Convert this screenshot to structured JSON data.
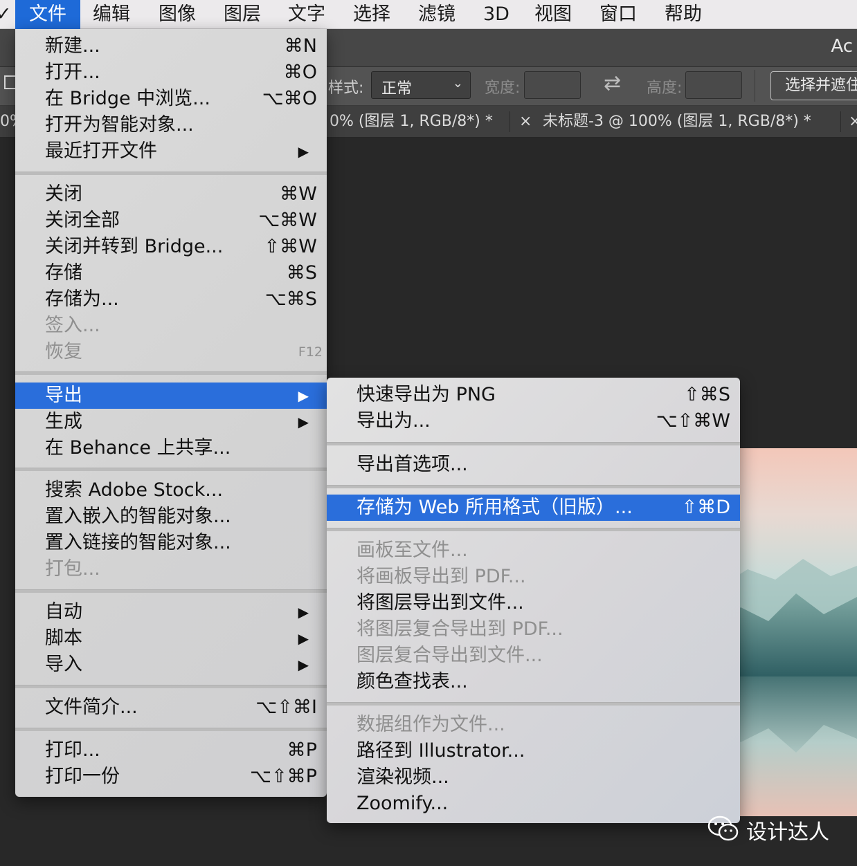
{
  "menubar": {
    "edge": "✓",
    "items": [
      "文件",
      "编辑",
      "图像",
      "图层",
      "文字",
      "选择",
      "滤镜",
      "3D",
      "视图",
      "窗口",
      "帮助"
    ],
    "active_index": 0
  },
  "app": {
    "title_fragment": "Ac"
  },
  "options_bar": {
    "style_label": "样式:",
    "style_value": "正常",
    "width_label": "宽度:",
    "height_label": "高度:",
    "select_mask_button": "选择并遮住"
  },
  "tabs": {
    "left_fragment": "0%",
    "tab1": "0% (图层 1, RGB/8*) *",
    "tab2_close": "×",
    "tab2": "未标题-3 @ 100% (图层 1, RGB/8*) *",
    "tab3_close": "×"
  },
  "file_menu": {
    "new": {
      "label": "新建...",
      "shortcut": "⌘N"
    },
    "open": {
      "label": "打开...",
      "shortcut": "⌘O"
    },
    "browse_bridge": {
      "label": "在 Bridge 中浏览...",
      "shortcut": "⌥⌘O"
    },
    "open_smart": {
      "label": "打开为智能对象..."
    },
    "recent": {
      "label": "最近打开文件",
      "arrow": "▶"
    },
    "close": {
      "label": "关闭",
      "shortcut": "⌘W"
    },
    "close_all": {
      "label": "关闭全部",
      "shortcut": "⌥⌘W"
    },
    "close_goto_bridge": {
      "label": "关闭并转到 Bridge...",
      "shortcut": "⇧⌘W"
    },
    "save": {
      "label": "存储",
      "shortcut": "⌘S"
    },
    "save_as": {
      "label": "存储为...",
      "shortcut": "⌥⌘S"
    },
    "check_in": {
      "label": "签入..."
    },
    "revert": {
      "label": "恢复",
      "shortcut": "F12"
    },
    "export": {
      "label": "导出",
      "arrow": "▶"
    },
    "generate": {
      "label": "生成",
      "arrow": "▶"
    },
    "share_behance": {
      "label": "在 Behance 上共享..."
    },
    "search_stock": {
      "label": "搜索 Adobe Stock..."
    },
    "place_embedded": {
      "label": "置入嵌入的智能对象..."
    },
    "place_linked": {
      "label": "置入链接的智能对象..."
    },
    "package": {
      "label": "打包..."
    },
    "automate": {
      "label": "自动",
      "arrow": "▶"
    },
    "scripts": {
      "label": "脚本",
      "arrow": "▶"
    },
    "import": {
      "label": "导入",
      "arrow": "▶"
    },
    "file_info": {
      "label": "文件简介...",
      "shortcut": "⌥⇧⌘I"
    },
    "print": {
      "label": "打印...",
      "shortcut": "⌘P"
    },
    "print_one": {
      "label": "打印一份",
      "shortcut": "⌥⇧⌘P"
    }
  },
  "export_submenu": {
    "quick_export_png": {
      "label": "快速导出为 PNG",
      "shortcut": "⇧⌘S"
    },
    "export_as": {
      "label": "导出为...",
      "shortcut": "⌥⇧⌘W"
    },
    "export_prefs": {
      "label": "导出首选项..."
    },
    "save_for_web": {
      "label": "存储为 Web 所用格式（旧版）...",
      "shortcut": "⇧⌘D"
    },
    "artboards_to_files": {
      "label": "画板至文件..."
    },
    "artboards_to_pdf": {
      "label": "将画板导出到 PDF..."
    },
    "layers_to_files": {
      "label": "将图层导出到文件..."
    },
    "layer_comps_to_pdf": {
      "label": "将图层复合导出到 PDF..."
    },
    "layer_comps_to_files": {
      "label": "图层复合导出到文件..."
    },
    "color_lookup": {
      "label": "颜色查找表..."
    },
    "data_sets_to_files": {
      "label": "数据组作为文件..."
    },
    "paths_to_illustrator": {
      "label": "路径到 Illustrator..."
    },
    "render_video": {
      "label": "渲染视频..."
    },
    "zoomify": {
      "label": "Zoomify..."
    }
  },
  "watermark": {
    "text": "设计达人"
  },
  "colors": {
    "highlight": "#2a6edb",
    "menubar_active": "#1e6ad8"
  }
}
